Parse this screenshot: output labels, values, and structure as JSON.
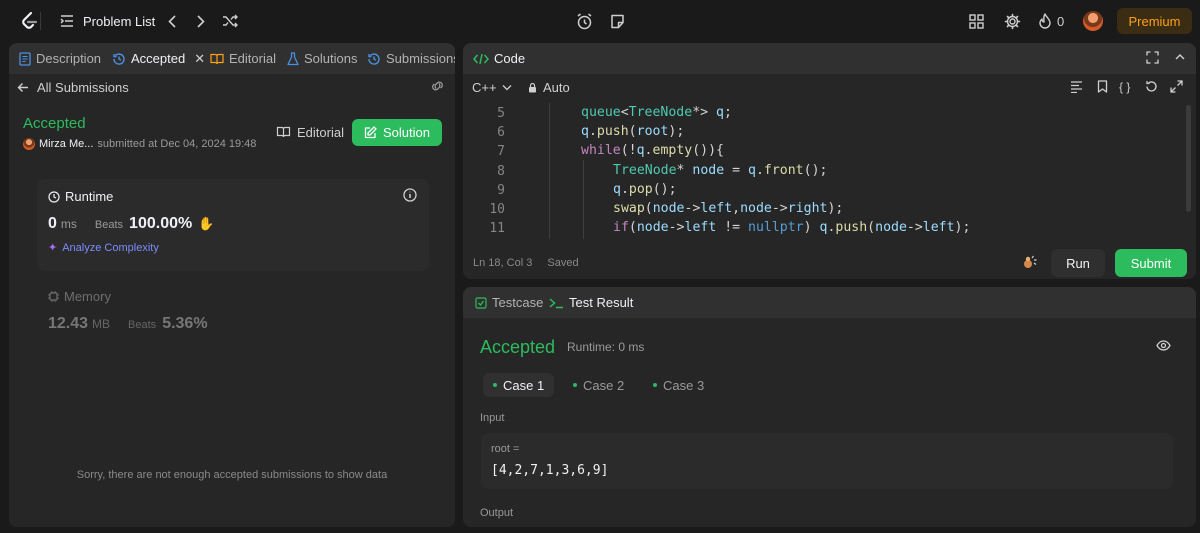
{
  "topbar": {
    "problem_list": "Problem List",
    "streak_count": "0",
    "premium": "Premium"
  },
  "left": {
    "tabs": {
      "description": "Description",
      "accepted": "Accepted",
      "editorial": "Editorial",
      "solutions": "Solutions",
      "submissions": "Submissions"
    },
    "back_label": "All Submissions",
    "status": "Accepted",
    "user_name": "Mirza Me...",
    "submitted_at": "submitted at Dec 04, 2024 19:48",
    "editorial_button": "Editorial",
    "solution_button": "Solution",
    "runtime": {
      "label": "Runtime",
      "value": "0",
      "unit": "ms",
      "beats_label": "Beats",
      "beats_value": "100.00%",
      "analyze": "Analyze Complexity"
    },
    "memory": {
      "label": "Memory",
      "value": "12.43",
      "unit": "MB",
      "beats_label": "Beats",
      "beats_value": "5.36%"
    },
    "empty_note": "Sorry, there are not enough accepted submissions to show data"
  },
  "code": {
    "tab_label": "Code",
    "language": "C++",
    "mode": "Auto",
    "lines": [
      {
        "n": "5",
        "text": "queue<TreeNode*> q;"
      },
      {
        "n": "6",
        "text": "q.push(root);"
      },
      {
        "n": "7",
        "text": "while(!q.empty()){"
      },
      {
        "n": "8",
        "text": "TreeNode* node = q.front();"
      },
      {
        "n": "9",
        "text": "q.pop();"
      },
      {
        "n": "10",
        "text": "swap(node->left,node->right);"
      },
      {
        "n": "11",
        "text": "if(node->left != nullptr) q.push(node->left);"
      }
    ],
    "cursor": "Ln 18, Col 3",
    "saved": "Saved",
    "run": "Run",
    "submit": "Submit"
  },
  "test": {
    "tab_testcase": "Testcase",
    "tab_result": "Test Result",
    "status": "Accepted",
    "runtime": "Runtime: 0 ms",
    "cases": [
      "Case 1",
      "Case 2",
      "Case 3"
    ],
    "input_label": "Input",
    "input_var": "root =",
    "input_value": "[4,2,7,1,3,6,9]",
    "output_label": "Output"
  },
  "colors": {
    "accent_green": "#2cbb5d",
    "premium": "#ffa116",
    "panel": "#262626",
    "background": "#1a1a1a"
  }
}
